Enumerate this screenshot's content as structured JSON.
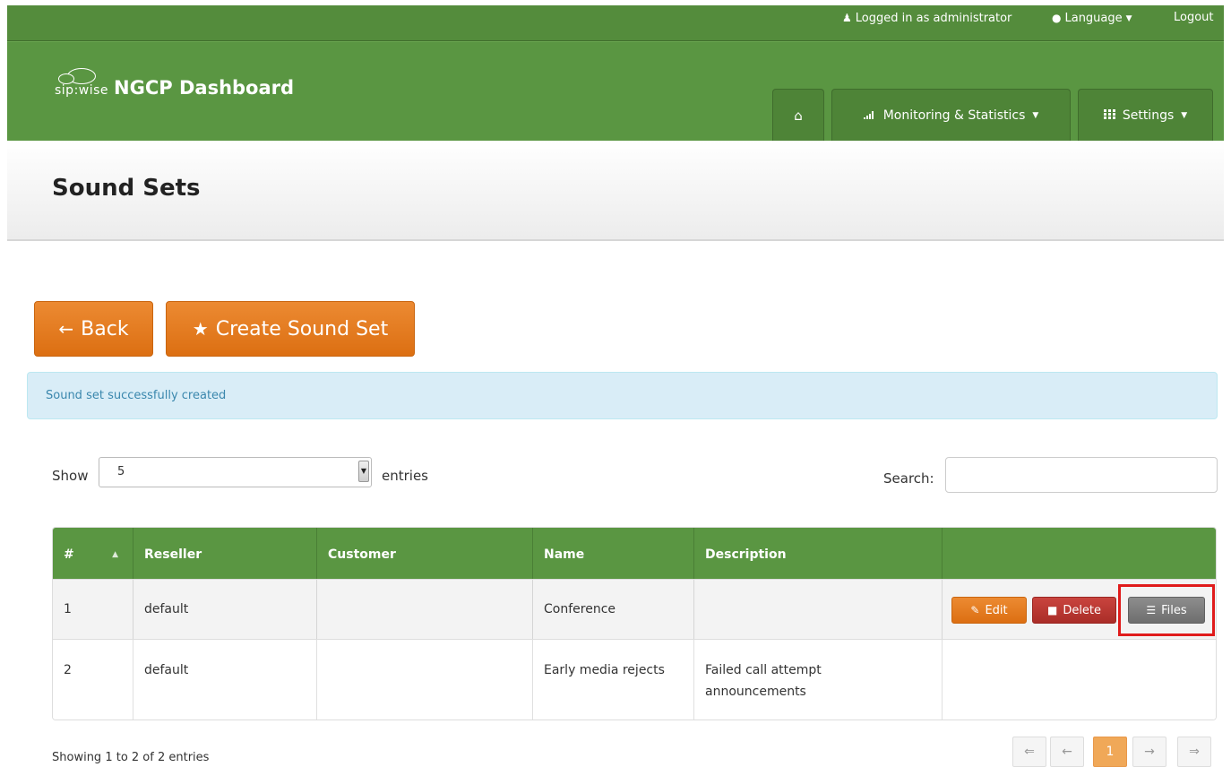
{
  "topbar": {
    "logged_in": "Logged in as administrator",
    "language": "Language",
    "logout": "Logout"
  },
  "brand": {
    "prefix": "sip:wise",
    "title": "NGCP Dashboard"
  },
  "nav": {
    "monitoring": "Monitoring & Statistics",
    "settings": "Settings"
  },
  "page": {
    "title": "Sound Sets"
  },
  "actions": {
    "back": "Back",
    "create": "Create Sound Set"
  },
  "alert": {
    "message": "Sound set successfully created"
  },
  "table_controls": {
    "show_label": "Show",
    "page_size": "5",
    "entries_label": "entries",
    "search_label": "Search:"
  },
  "table": {
    "columns": [
      "#",
      "Reseller",
      "Customer",
      "Name",
      "Description",
      ""
    ],
    "rows": [
      {
        "id": "1",
        "reseller": "default",
        "customer": "",
        "name": "Conference",
        "description": ""
      },
      {
        "id": "2",
        "reseller": "default",
        "customer": "",
        "name": "Early media rejects",
        "description": "Failed call attempt announcements"
      }
    ],
    "row_actions": {
      "edit": "Edit",
      "delete": "Delete",
      "files": "Files"
    }
  },
  "footer": {
    "showing": "Showing 1 to 2 of 2 entries",
    "pager": {
      "first": "⇐",
      "prev": "←",
      "current": "1",
      "next": "→",
      "last": "⇒"
    }
  },
  "colors": {
    "brand_green": "#5a9642",
    "accent_orange": "#e27c20",
    "delete_red": "#b8342f",
    "highlight_red": "#e01b1b"
  }
}
